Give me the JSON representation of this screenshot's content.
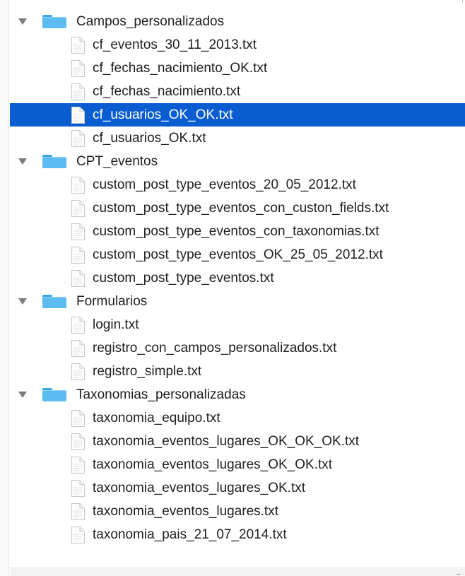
{
  "tree": [
    {
      "folder": "Campos_personalizados",
      "files": [
        "cf_eventos_30_11_2013.txt",
        "cf_fechas_nacimiento_OK.txt",
        "cf_fechas_nacimiento.txt",
        "cf_usuarios_OK_OK.txt",
        "cf_usuarios_OK.txt"
      ]
    },
    {
      "folder": "CPT_eventos",
      "files": [
        "custom_post_type_eventos_20_05_2012.txt",
        "custom_post_type_eventos_con_custon_fields.txt",
        "custom_post_type_eventos_con_taxonomias.txt",
        "custom_post_type_eventos_OK_25_05_2012.txt",
        "custom_post_type_eventos.txt"
      ]
    },
    {
      "folder": "Formularios",
      "files": [
        "login.txt",
        "registro_con_campos_personalizados.txt",
        "registro_simple.txt"
      ]
    },
    {
      "folder": "Taxonomias_personalizadas",
      "files": [
        "taxonomia_equipo.txt",
        "taxonomia_eventos_lugares_OK_OK_OK.txt",
        "taxonomia_eventos_lugares_OK_OK.txt",
        "taxonomia_eventos_lugares_OK.txt",
        "taxonomia_eventos_lugares.txt",
        "taxonomia_pais_21_07_2014.txt"
      ]
    }
  ],
  "selected_file": "cf_usuarios_OK_OK.txt",
  "icons": {
    "folder": "folder-icon",
    "file": "text-file-icon",
    "disclosure": "disclosure-triangle-icon"
  },
  "colors": {
    "selection": "#0a5dd1",
    "folder": "#5cbcf2",
    "text": "#1f1f1f",
    "selected_text": "#ffffff"
  }
}
